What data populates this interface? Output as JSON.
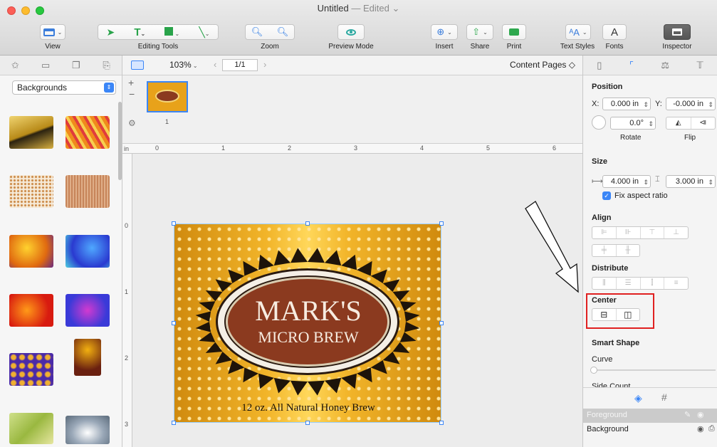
{
  "window": {
    "title": "Untitled",
    "status": "— Edited ⌄"
  },
  "toolbar": {
    "view": "View",
    "editing_tools": "Editing Tools",
    "zoom": "Zoom",
    "preview_mode": "Preview Mode",
    "insert": "Insert",
    "share": "Share",
    "print": "Print",
    "text_styles": "Text Styles",
    "fonts": "Fonts",
    "inspector": "Inspector"
  },
  "sidebar": {
    "select_value": "Backgrounds",
    "thumbnails": [
      "gold-ink",
      "orange-streaks",
      "speckled-cream",
      "rust-texture",
      "fire-yellow",
      "blue-purple",
      "red-orange",
      "violet-blue",
      "purple-floral",
      "autumn-leaf",
      "green-yellow",
      "silver-swirl"
    ]
  },
  "canvas": {
    "zoom_value": "103%",
    "page_counter": "1/1",
    "content_pages": "Content Pages ◇",
    "page_thumb_number": "1",
    "ruler_unit": "in",
    "ruler_h": [
      "0",
      "1",
      "2",
      "3",
      "4",
      "5",
      "6"
    ],
    "ruler_v": [
      "0",
      "1",
      "2",
      "3"
    ],
    "label_top": "MARK'S",
    "label_bottom": "MICRO BREW",
    "label_caption": "12 oz. All Natural Honey Brew"
  },
  "inspector": {
    "position_title": "Position",
    "x_label": "X:",
    "x_value": "0.000 in",
    "y_label": "Y:",
    "y_value": "-0.000 in",
    "rotate_value": "0.0°",
    "rotate_label": "Rotate",
    "flip_label": "Flip",
    "size_title": "Size",
    "width_value": "4.000 in",
    "height_value": "3.000 in",
    "fix_aspect": "Fix aspect ratio",
    "fix_aspect_checked": true,
    "align_title": "Align",
    "distribute_title": "Distribute",
    "center_title": "Center",
    "smart_shape_title": "Smart Shape",
    "curve_label": "Curve",
    "side_count_label": "Side Count",
    "layers": [
      "Foreground",
      "Background"
    ]
  },
  "colors": {
    "accent": "#3b86f7",
    "highlight_box": "#e02020",
    "label_gold": "#e8a21a",
    "oval_brown": "#8b3a1f"
  }
}
